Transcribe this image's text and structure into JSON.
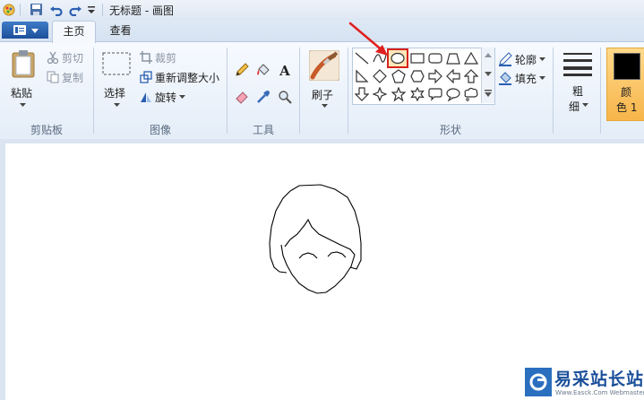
{
  "window": {
    "title": "无标题 - 画图"
  },
  "tabs": {
    "home": "主页",
    "view": "查看"
  },
  "clipboard": {
    "paste": "粘贴",
    "cut": "剪切",
    "copy": "复制",
    "group": "剪贴板"
  },
  "image": {
    "select": "选择",
    "crop": "裁剪",
    "resize": "重新调整大小",
    "rotate": "旋转",
    "group": "图像"
  },
  "tools": {
    "group": "工具"
  },
  "brushes": {
    "label": "刷子"
  },
  "shapes": {
    "group": "形状",
    "outline": "轮廓",
    "fill": "填充",
    "items": [
      "line",
      "curve",
      "oval",
      "rectangle",
      "rounded-rectangle",
      "polygon",
      "triangle",
      "right-triangle",
      "diamond",
      "pentagon",
      "hexagon",
      "right-arrow",
      "left-arrow",
      "up-arrow",
      "down-arrow",
      "four-point-star",
      "five-point-star",
      "six-point-star",
      "rounded-callout",
      "oval-callout",
      "cloud-callout"
    ],
    "selected": "oval"
  },
  "size": {
    "label_top": "粗",
    "label_bottom": "细"
  },
  "color1": {
    "label_top": "颜",
    "label_bottom": "色 1",
    "value": "#000000"
  },
  "accent": {
    "highlight": "#e02020",
    "selection": "#f7b54a"
  },
  "watermark": {
    "brand": "易采站长站",
    "subtext": "Www.Easck.Com Webmaster"
  }
}
